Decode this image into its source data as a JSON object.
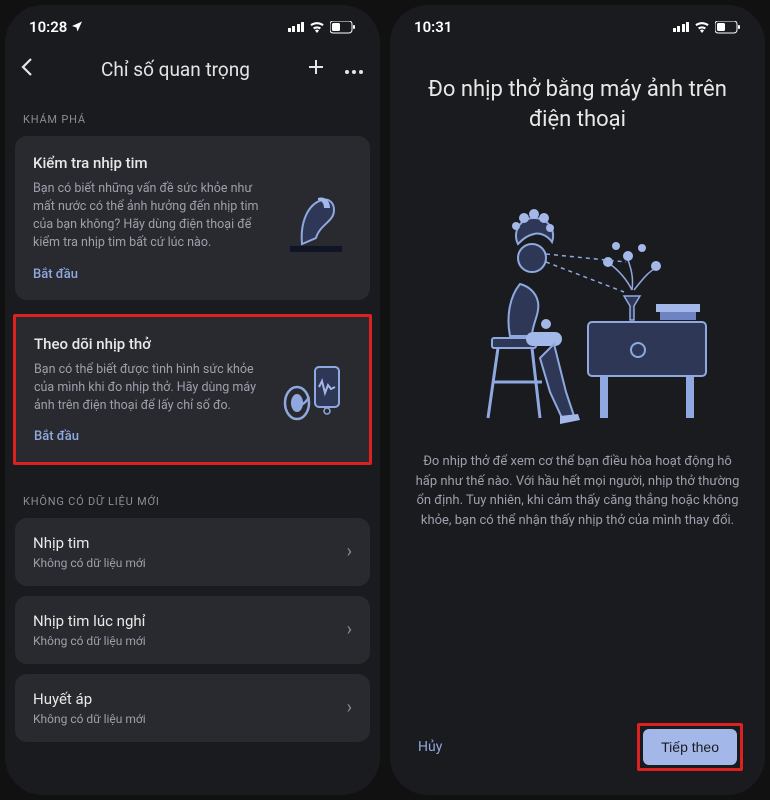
{
  "phone1": {
    "time": "10:28",
    "nav_title": "Chỉ số quan trọng",
    "sections": {
      "explore": "KHÁM PHÁ",
      "no_new": "KHÔNG CÓ DỮ LIỆU MỚI"
    },
    "cards": [
      {
        "title": "Kiểm tra nhịp tim",
        "desc": "Bạn có biết những vấn đề sức khỏe như mất nước có thể ảnh hưởng đến nhịp tim của bạn không? Hãy dùng điện thoại để kiểm tra nhịp tim bất cứ lúc nào.",
        "action": "Bắt đầu"
      },
      {
        "title": "Theo dõi nhịp thở",
        "desc": "Bạn có thể biết được tình hình sức khỏe của mình khi đo nhịp thở. Hãy dùng máy ảnh trên điện thoại để lấy chỉ số đo.",
        "action": "Bắt đầu"
      }
    ],
    "metrics": [
      {
        "title": "Nhịp tim",
        "sub": "Không có dữ liệu mới"
      },
      {
        "title": "Nhịp tim lúc nghỉ",
        "sub": "Không có dữ liệu mới"
      },
      {
        "title": "Huyết áp",
        "sub": "Không có dữ liệu mới"
      }
    ]
  },
  "phone2": {
    "time": "10:31",
    "title": "Đo nhịp thở bằng máy ảnh trên điện thoại",
    "desc": "Đo nhịp thở để xem cơ thể bạn điều hòa hoạt động hô hấp như thế nào. Với hầu hết mọi người, nhịp thở thường ổn định. Tuy nhiên, khi cảm thấy căng thẳng hoặc không khỏe, bạn có thể nhận thấy nhịp thở của mình thay đổi.",
    "cancel": "Hủy",
    "next": "Tiếp theo"
  }
}
